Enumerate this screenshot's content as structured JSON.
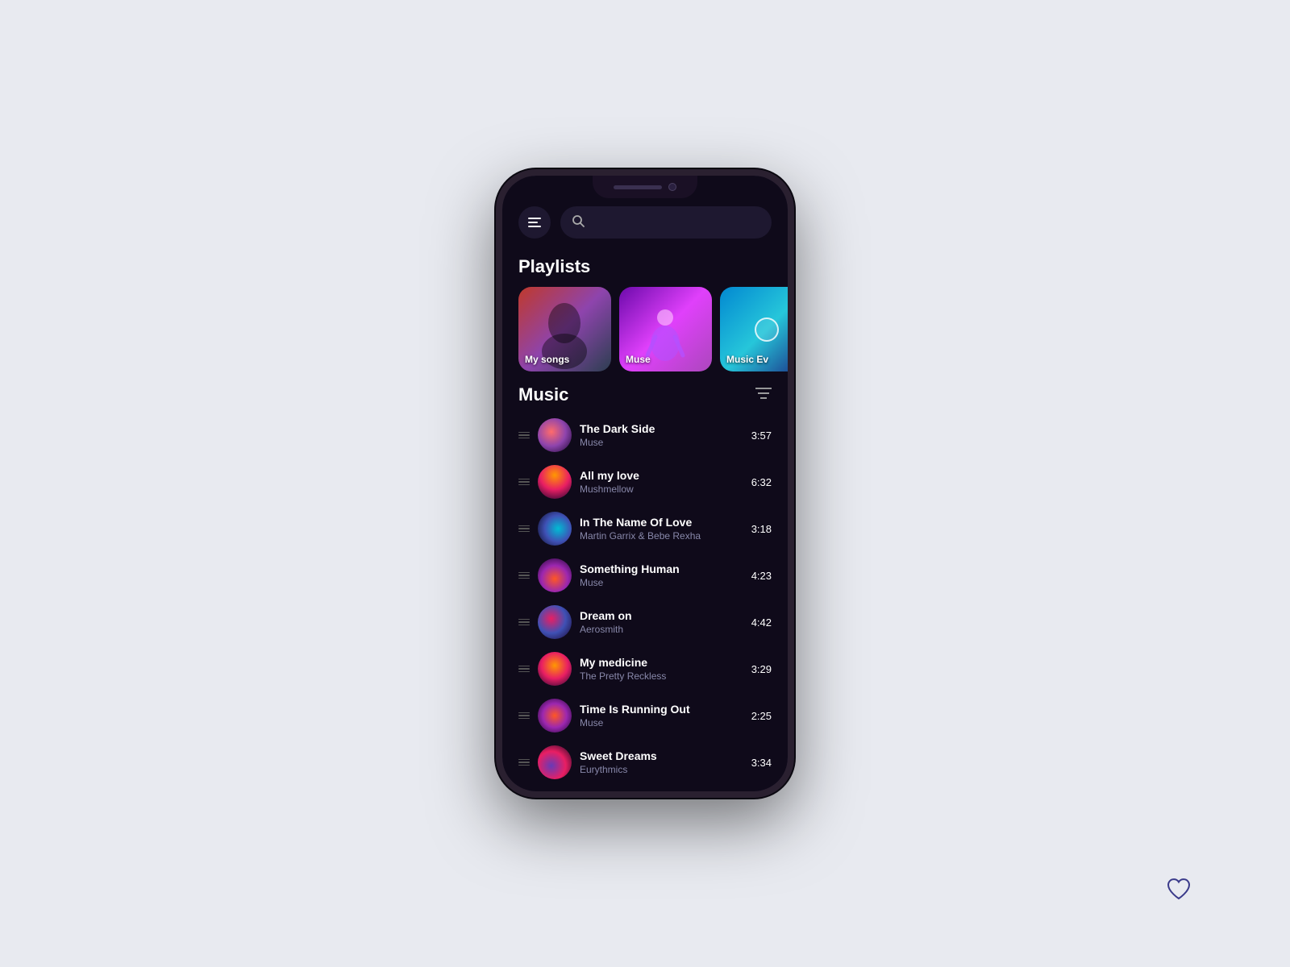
{
  "page": {
    "background": "#e8eaf0"
  },
  "header": {
    "menu_label": "menu",
    "search_placeholder": ""
  },
  "playlists": {
    "section_title": "Playlists",
    "items": [
      {
        "label": "My songs",
        "art": "art-mysongs"
      },
      {
        "label": "Muse",
        "art": "art-muse"
      },
      {
        "label": "Music Ev",
        "art": "art-music-ev"
      }
    ]
  },
  "music": {
    "section_title": "Music",
    "tracks": [
      {
        "name": "The Dark Side",
        "artist": "Muse",
        "duration": "3:57",
        "art": "art-1"
      },
      {
        "name": "All my love",
        "artist": "Mushmellow",
        "duration": "6:32",
        "art": "art-2"
      },
      {
        "name": "In The Name Of Love",
        "artist": "Martin Garrix & Bebe Rexha",
        "duration": "3:18",
        "art": "art-3"
      },
      {
        "name": "Something Human",
        "artist": "Muse",
        "duration": "4:23",
        "art": "art-4"
      },
      {
        "name": "Dream on",
        "artist": "Aerosmith",
        "duration": "4:42",
        "art": "art-5"
      },
      {
        "name": "My medicine",
        "artist": "The Pretty Reckless",
        "duration": "3:29",
        "art": "art-6"
      },
      {
        "name": "Time Is Running Out",
        "artist": "Muse",
        "duration": "2:25",
        "art": "art-7"
      },
      {
        "name": "Sweet Dreams",
        "artist": "Eurythmics",
        "duration": "3:34",
        "art": "art-8"
      }
    ]
  },
  "heart_icon": "♡"
}
